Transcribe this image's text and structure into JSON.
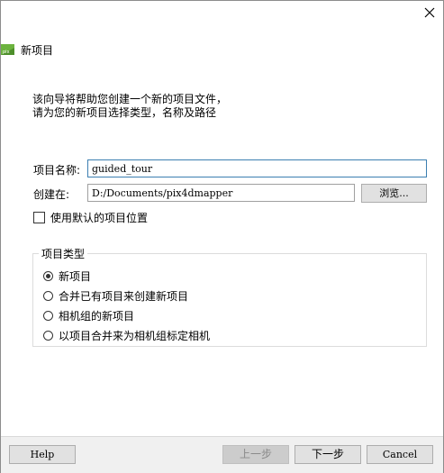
{
  "window": {
    "title": "新项目"
  },
  "intro": {
    "line1": "该向导将帮助您创建一个新的项目文件，",
    "line2": "请为您的新项目选择类型，名称及路径"
  },
  "form": {
    "name_label": "项目名称:",
    "name_value": "guided_tour",
    "location_label": "创建在:",
    "location_value": "D:/Documents/pix4dmapper",
    "browse_label": "浏览...",
    "default_location_label": "使用默认的项目位置",
    "default_location_checked": false
  },
  "project_type": {
    "title": "项目类型",
    "options": [
      {
        "label": "新项目",
        "selected": true
      },
      {
        "label": "合并已有项目来创建新项目",
        "selected": false
      },
      {
        "label": "相机组的新项目",
        "selected": false
      },
      {
        "label": "以项目合并来为相机组标定相机",
        "selected": false
      }
    ]
  },
  "footer": {
    "help_label": "Help",
    "back_label": "上一步",
    "next_label": "下一步",
    "cancel_label": "Cancel"
  },
  "colors": {
    "focus_border": "#3c7fb1",
    "app_icon_green": "#6cb33f"
  },
  "icons": {
    "close": "close-icon",
    "app": "pix4d-app-icon"
  }
}
